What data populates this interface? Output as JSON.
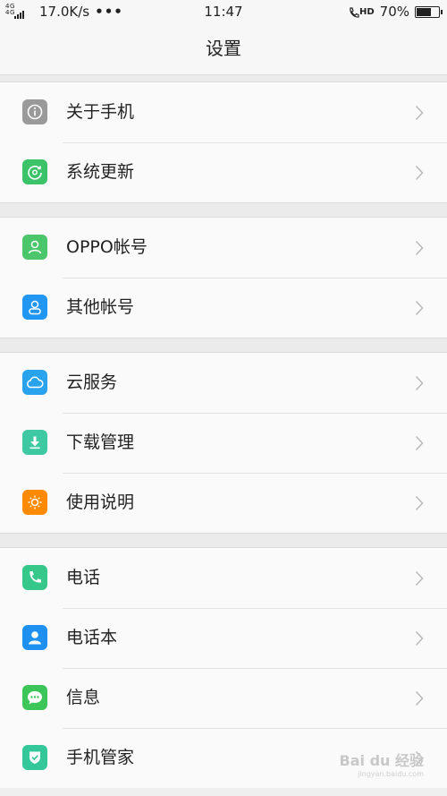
{
  "status_bar": {
    "network": "4G 4G",
    "speed": "17.0K/s",
    "more": "•••",
    "time": "11:47",
    "hd": "HD",
    "battery": "70%",
    "battery_level": 0.7
  },
  "title": "设置",
  "groups": [
    {
      "items": [
        {
          "label": "关于手机",
          "icon": "info-icon",
          "color": "#9a9a9a"
        },
        {
          "label": "系统更新",
          "icon": "update-icon",
          "color": "#3cc36a"
        }
      ]
    },
    {
      "items": [
        {
          "label": "OPPO帐号",
          "icon": "person-icon",
          "color": "#4cc66a"
        },
        {
          "label": "其他帐号",
          "icon": "account-icon",
          "color": "#2196f3"
        }
      ]
    },
    {
      "items": [
        {
          "label": "云服务",
          "icon": "cloud-icon",
          "color": "#2aa3ef"
        },
        {
          "label": "下载管理",
          "icon": "download-icon",
          "color": "#3ec9a2"
        },
        {
          "label": "使用说明",
          "icon": "lightbulb-icon",
          "color": "#ff8a00"
        }
      ]
    },
    {
      "items": [
        {
          "label": "电话",
          "icon": "phone-icon",
          "color": "#36c88a"
        },
        {
          "label": "电话本",
          "icon": "contacts-icon",
          "color": "#1e90f0"
        },
        {
          "label": "信息",
          "icon": "message-icon",
          "color": "#3cc65a"
        },
        {
          "label": "手机管家",
          "icon": "shield-icon",
          "color": "#33c79a"
        }
      ]
    }
  ],
  "watermark": {
    "text": "Bai du 经验",
    "sub": "jingyan.baidu.com"
  }
}
